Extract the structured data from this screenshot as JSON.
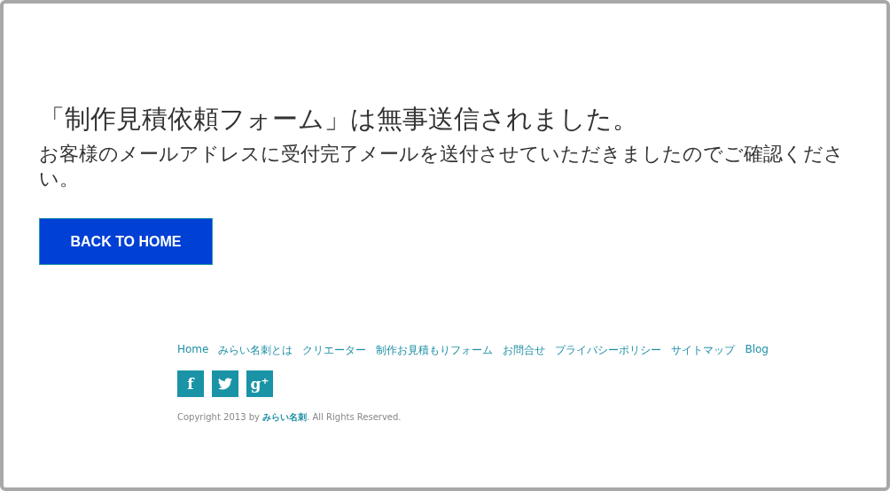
{
  "message": {
    "title": "「制作見積依頼フォーム」は無事送信されました。",
    "body": "お客様のメールアドレスに受付完了メールを送付させていただきましたのでご確認ください。"
  },
  "button": {
    "label": "BACK TO HOME"
  },
  "footer": {
    "links": [
      "Home",
      "みらい名刺とは",
      "クリエーター",
      "制作お見積もりフォーム",
      "お問合せ",
      "プライバシーポリシー",
      "サイトマップ",
      "Blog"
    ],
    "social": [
      {
        "kind": "facebook",
        "glyph": "f"
      },
      {
        "kind": "twitter"
      },
      {
        "kind": "gplus",
        "glyph": "g⁺"
      }
    ],
    "copyright": {
      "before": "Copyright 2013 by ",
      "link": "みらい名刺",
      "after": ". All Rights Reserved."
    }
  }
}
